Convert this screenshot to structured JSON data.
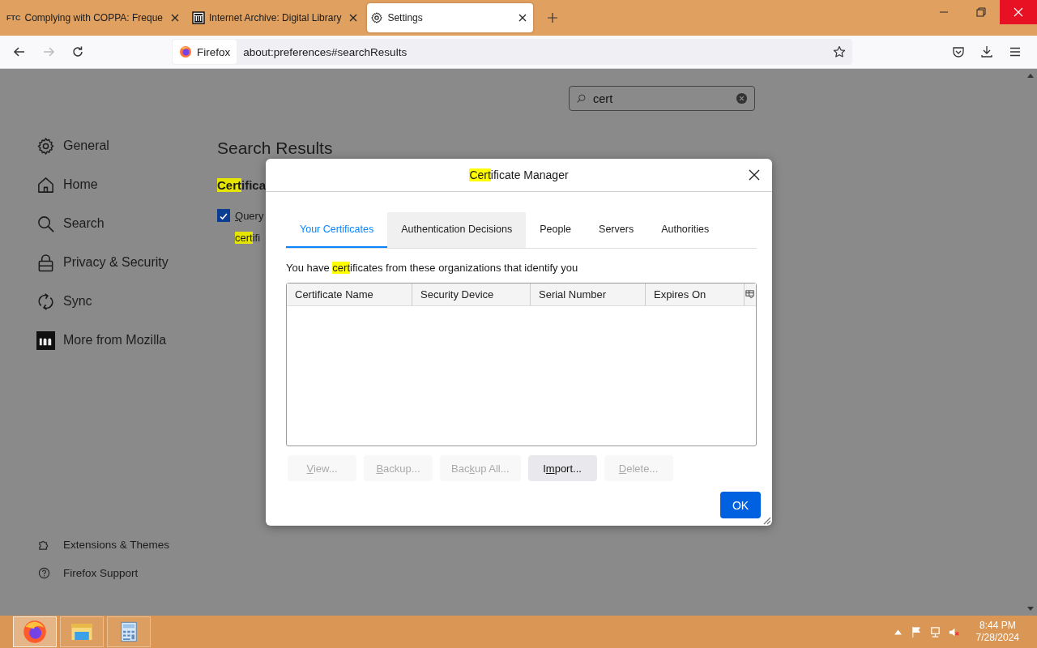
{
  "browser_tabs": [
    {
      "kind": "text-favicon",
      "favicon_text": "FTC",
      "title": "Complying with COPPA: Freque",
      "selected": false
    },
    {
      "kind": "archive",
      "title": "Internet Archive: Digital Library",
      "selected": false
    },
    {
      "kind": "gear",
      "title": "Settings",
      "selected": true
    }
  ],
  "address_bar": {
    "identity": "Firefox",
    "url": "about:preferences#searchResults"
  },
  "search": {
    "value": "cert"
  },
  "sidebar": {
    "items": [
      {
        "kind": "gear",
        "label": "General"
      },
      {
        "kind": "home",
        "label": "Home"
      },
      {
        "kind": "search",
        "label": "Search"
      },
      {
        "kind": "lock",
        "label": "Privacy & Security"
      },
      {
        "kind": "sync",
        "label": "Sync"
      },
      {
        "kind": "mozilla",
        "label": "More from Mozilla"
      }
    ],
    "footer_links": [
      {
        "kind": "puzzle",
        "label": "Extensions & Themes"
      },
      {
        "kind": "help",
        "label": "Firefox Support"
      }
    ]
  },
  "search_results": {
    "heading": "Search Results",
    "group_title": [
      {
        "text": "Cert",
        "highlighted": true
      },
      {
        "text": "ifica",
        "highlighted": false
      }
    ],
    "checkbox": {
      "checked": true,
      "label": [
        {
          "text": "Q",
          "highlighted": false,
          "underlined": true
        },
        {
          "text": "uery ",
          "highlighted": false,
          "underlined": false
        },
        {
          "text": "cert",
          "highlighted": true,
          "underlined": false
        },
        {
          "text": "ifi",
          "highlighted": false,
          "underlined": false
        }
      ]
    }
  },
  "dialog": {
    "title": [
      {
        "text": "Cert",
        "highlighted": true
      },
      {
        "text": "ificate Manager",
        "highlighted": false
      }
    ],
    "tabs": [
      {
        "label": "Your Certificates",
        "selected": true,
        "hovered": false
      },
      {
        "label": "Authentication Decisions",
        "selected": false,
        "hovered": true
      },
      {
        "label": "People",
        "selected": false,
        "hovered": false
      },
      {
        "label": "Servers",
        "selected": false,
        "hovered": false
      },
      {
        "label": "Authorities",
        "selected": false,
        "hovered": false
      }
    ],
    "description": [
      {
        "text": "You have ",
        "highlighted": false
      },
      {
        "text": "cert",
        "highlighted": true
      },
      {
        "text": "ificates from these organizations that identify you",
        "highlighted": false
      }
    ],
    "columns": [
      "Certificate Name",
      "Security Device",
      "Serial Number",
      "Expires On"
    ],
    "buttons": [
      {
        "label": [
          {
            "text": "V",
            "underlined": true
          },
          {
            "text": "iew...",
            "underlined": false
          }
        ],
        "disabled": true
      },
      {
        "label": [
          {
            "text": "B",
            "underlined": true
          },
          {
            "text": "ackup...",
            "underlined": false
          }
        ],
        "disabled": true
      },
      {
        "label": [
          {
            "text": "Bac",
            "underlined": false
          },
          {
            "text": "k",
            "underlined": true
          },
          {
            "text": "up All...",
            "underlined": false
          }
        ],
        "disabled": true
      },
      {
        "label": [
          {
            "text": "I",
            "underlined": false
          },
          {
            "text": "m",
            "underlined": true
          },
          {
            "text": "port...",
            "underlined": false
          }
        ],
        "disabled": false
      },
      {
        "label": [
          {
            "text": "D",
            "underlined": true
          },
          {
            "text": "elete...",
            "underlined": false
          }
        ],
        "disabled": true
      }
    ],
    "ok": "OK"
  },
  "taskbar": {
    "apps": [
      {
        "kind": "firefox",
        "active": true
      },
      {
        "kind": "explorer",
        "active": false
      },
      {
        "kind": "calculator",
        "active": false
      }
    ],
    "time": "8:44 PM",
    "date": "7/28/2024"
  }
}
